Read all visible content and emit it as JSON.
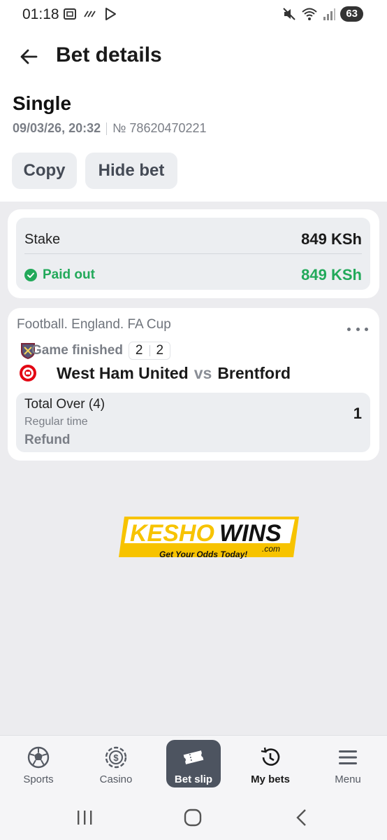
{
  "status_bar": {
    "time": "01:18",
    "battery": "63"
  },
  "header": {
    "title": "Bet details"
  },
  "bet": {
    "type": "Single",
    "datetime": "09/03/26, 20:32",
    "number": "№ 78620470221",
    "copy_label": "Copy",
    "hide_label": "Hide bet"
  },
  "stake": {
    "label": "Stake",
    "value": "849 KSh",
    "paid_label": "Paid out",
    "paid_value": "849 KSh"
  },
  "event": {
    "league": "Football. England. FA Cup",
    "status": "Game finished",
    "score_home": "2",
    "score_away": "2",
    "home_team": "West Ham United",
    "vs": "vs",
    "away_team": "Brentford",
    "market": "Total Over (4)",
    "period": "Regular time",
    "result": "Refund",
    "odds": "1"
  },
  "logo": {
    "brand_part1": "KESHO",
    "brand_part2": "WINS",
    "domain": ".com",
    "tagline": "Get Your Odds Today!"
  },
  "bottom_nav": {
    "items": [
      {
        "label": "Sports",
        "icon": "soccer-ball-icon"
      },
      {
        "label": "Casino",
        "icon": "casino-chip-icon"
      },
      {
        "label": "Bet slip",
        "icon": "ticket-icon"
      },
      {
        "label": "My bets",
        "icon": "history-icon"
      },
      {
        "label": "Menu",
        "icon": "hamburger-icon"
      }
    ],
    "active": "Bet slip"
  },
  "colors": {
    "accent_green": "#22a95a",
    "nav_active_bg": "#4d5460",
    "logo_yellow": "#f7c300"
  }
}
